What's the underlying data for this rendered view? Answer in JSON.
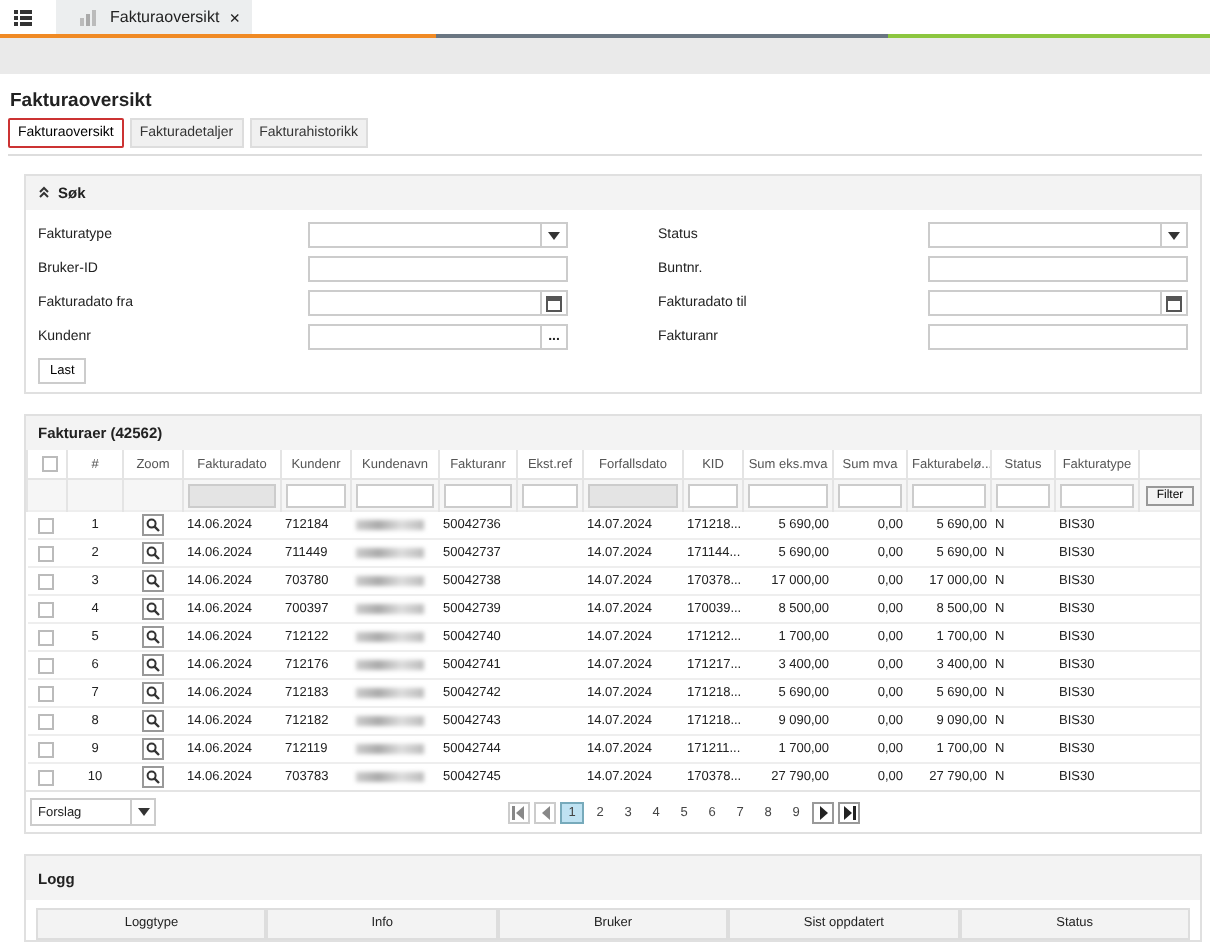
{
  "top_tab": {
    "label": "Fakturaoversikt",
    "close": "×"
  },
  "page_title": "Fakturaoversikt",
  "tabs": [
    {
      "label": "Fakturaoversikt",
      "selected": true
    },
    {
      "label": "Fakturadetaljer",
      "selected": false
    },
    {
      "label": "Fakturahistorikk",
      "selected": false
    }
  ],
  "search": {
    "title": "Søk",
    "expanded": true,
    "fields": [
      {
        "label": "Fakturatype",
        "kind": "select"
      },
      {
        "label": "Status",
        "kind": "select"
      },
      {
        "label": "Bruker-ID",
        "kind": "text"
      },
      {
        "label": "Buntnr.",
        "kind": "text"
      },
      {
        "label": "Fakturadato fra",
        "kind": "date"
      },
      {
        "label": "Fakturadato til",
        "kind": "date"
      },
      {
        "label": "Kundenr",
        "kind": "lookup",
        "button": "..."
      },
      {
        "label": "Fakturanr",
        "kind": "text"
      }
    ],
    "button": "Last"
  },
  "table": {
    "title": "Fakturaer (42562)",
    "all_checked": false,
    "columns": [
      {
        "label": "#",
        "kind": "plain"
      },
      {
        "label": "Zoom",
        "kind": "plain"
      },
      {
        "label": "Fakturadato",
        "kind": "locked"
      },
      {
        "label": "Kundenr",
        "kind": "filterable"
      },
      {
        "label": "Kundenavn",
        "kind": "filterable"
      },
      {
        "label": "Fakturanr",
        "kind": "filterable"
      },
      {
        "label": "Ekst.ref",
        "kind": "filterable"
      },
      {
        "label": "Forfallsdato",
        "kind": "locked"
      },
      {
        "label": "KID",
        "kind": "filterable"
      },
      {
        "label": "Sum eks.mva",
        "kind": "filterable"
      },
      {
        "label": "Sum mva",
        "kind": "filterable"
      },
      {
        "label": "Fakturabelø...",
        "kind": "filterable"
      },
      {
        "label": "Status",
        "kind": "filterable"
      },
      {
        "label": "Fakturatype",
        "kind": "filterable"
      }
    ],
    "filter_button": "Filter",
    "rows": [
      {
        "checked": false,
        "cells": [
          "1",
          "",
          "14.06.2024",
          "712184",
          "",
          "50042736",
          "",
          "14.07.2024",
          "171218...",
          "5 690,00",
          "0,00",
          "5 690,00",
          "N",
          "BIS30"
        ]
      },
      {
        "checked": false,
        "cells": [
          "2",
          "",
          "14.06.2024",
          "711449",
          "",
          "50042737",
          "",
          "14.07.2024",
          "171144...",
          "5 690,00",
          "0,00",
          "5 690,00",
          "N",
          "BIS30"
        ]
      },
      {
        "checked": false,
        "cells": [
          "3",
          "",
          "14.06.2024",
          "703780",
          "",
          "50042738",
          "",
          "14.07.2024",
          "170378...",
          "17 000,00",
          "0,00",
          "17 000,00",
          "N",
          "BIS30"
        ]
      },
      {
        "checked": false,
        "cells": [
          "4",
          "",
          "14.06.2024",
          "700397",
          "",
          "50042739",
          "",
          "14.07.2024",
          "170039...",
          "8 500,00",
          "0,00",
          "8 500,00",
          "N",
          "BIS30"
        ]
      },
      {
        "checked": false,
        "cells": [
          "5",
          "",
          "14.06.2024",
          "712122",
          "",
          "50042740",
          "",
          "14.07.2024",
          "171212...",
          "1 700,00",
          "0,00",
          "1 700,00",
          "N",
          "BIS30"
        ]
      },
      {
        "checked": false,
        "cells": [
          "6",
          "",
          "14.06.2024",
          "712176",
          "",
          "50042741",
          "",
          "14.07.2024",
          "171217...",
          "3 400,00",
          "0,00",
          "3 400,00",
          "N",
          "BIS30"
        ]
      },
      {
        "checked": false,
        "cells": [
          "7",
          "",
          "14.06.2024",
          "712183",
          "",
          "50042742",
          "",
          "14.07.2024",
          "171218...",
          "5 690,00",
          "0,00",
          "5 690,00",
          "N",
          "BIS30"
        ]
      },
      {
        "checked": false,
        "cells": [
          "8",
          "",
          "14.06.2024",
          "712182",
          "",
          "50042743",
          "",
          "14.07.2024",
          "171218...",
          "9 090,00",
          "0,00",
          "9 090,00",
          "N",
          "BIS30"
        ]
      },
      {
        "checked": false,
        "cells": [
          "9",
          "",
          "14.06.2024",
          "712119",
          "",
          "50042744",
          "",
          "14.07.2024",
          "171211...",
          "1 700,00",
          "0,00",
          "1 700,00",
          "N",
          "BIS30"
        ]
      },
      {
        "checked": false,
        "cells": [
          "10",
          "",
          "14.06.2024",
          "703783",
          "",
          "50042745",
          "",
          "14.07.2024",
          "170378...",
          "27 790,00",
          "0,00",
          "27 790,00",
          "N",
          "BIS30"
        ]
      }
    ]
  },
  "pager": {
    "layout_select": "Forslag",
    "pages": [
      {
        "label": "1",
        "selected": true
      },
      {
        "label": "2",
        "selected": false
      },
      {
        "label": "3",
        "selected": false
      },
      {
        "label": "4",
        "selected": false
      },
      {
        "label": "5",
        "selected": false
      },
      {
        "label": "6",
        "selected": false
      },
      {
        "label": "7",
        "selected": false
      },
      {
        "label": "8",
        "selected": false
      },
      {
        "label": "9",
        "selected": false
      }
    ]
  },
  "log": {
    "title": "Logg",
    "columns": [
      "Loggtype",
      "Info",
      "Bruker",
      "Sist oppdatert",
      "Status"
    ]
  }
}
